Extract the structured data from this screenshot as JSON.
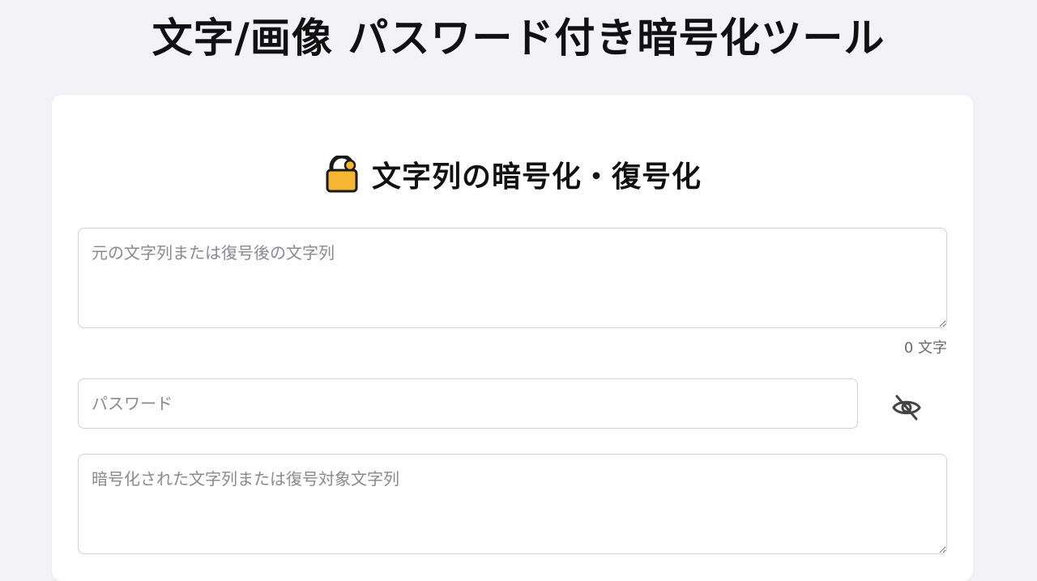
{
  "page": {
    "title": "文字/画像 パスワード付き暗号化ツール"
  },
  "section": {
    "heading": "文字列の暗号化・復号化",
    "heading_icon": "lock-icon"
  },
  "plain_text": {
    "value": "",
    "placeholder": "元の文字列または復号後の文字列",
    "char_count_label": "0 文字"
  },
  "password": {
    "value": "",
    "placeholder": "パスワード",
    "toggle_icon": "eye-slash-icon"
  },
  "cipher_text": {
    "value": "",
    "placeholder": "暗号化された文字列または復号対象文字列"
  },
  "colors": {
    "background": "#f2f2f7",
    "card": "#ffffff",
    "lock_body": "#f5b731",
    "border": "#d0d0d5"
  }
}
